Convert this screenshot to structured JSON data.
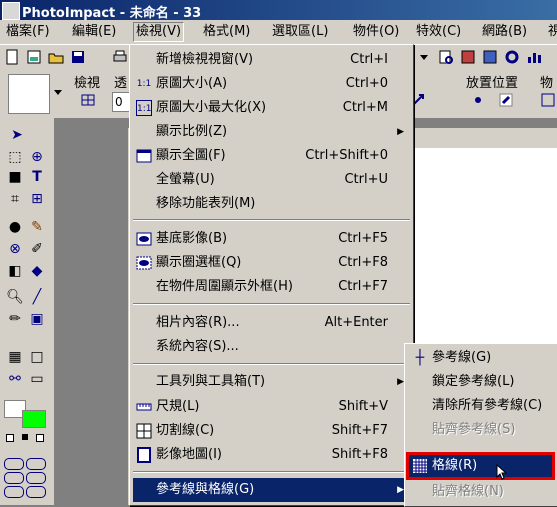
{
  "window": {
    "title": "PhotoImpact - 未命名 - 33"
  },
  "menubar": [
    {
      "label": "檔案(F)",
      "active": false
    },
    {
      "label": "編輯(E)",
      "active": false
    },
    {
      "label": "檢視(V)",
      "active": true
    },
    {
      "label": "格式(M)",
      "active": false
    },
    {
      "label": "選取區(L)",
      "active": false
    },
    {
      "label": "物件(O)",
      "active": false
    },
    {
      "label": "特效(C)",
      "active": false
    },
    {
      "label": "網路(B)",
      "active": false
    },
    {
      "label": "視",
      "active": false
    }
  ],
  "toolbar2": {
    "view_label": "檢視",
    "transparency_label": "透",
    "field_value": "0",
    "placement_label": "放置位置",
    "object_label": "物"
  },
  "view_menu": {
    "items": [
      {
        "label": "新增檢視視窗(V)",
        "accel": "Ctrl+I",
        "icon": ""
      },
      {
        "label": "原圖大小(A)",
        "accel": "Ctrl+0",
        "icon": "1:1"
      },
      {
        "label": "原圖大小最大化(X)",
        "accel": "Ctrl+M",
        "icon": "1:1"
      },
      {
        "label": "顯示比例(Z)",
        "accel": "",
        "icon": "",
        "submenu": true
      },
      {
        "label": "顯示全圖(F)",
        "accel": "Ctrl+Shift+0",
        "icon": "fit-icon"
      },
      {
        "label": "全螢幕(U)",
        "accel": "Ctrl+U",
        "icon": ""
      },
      {
        "label": "移除功能表列(M)",
        "accel": "",
        "icon": ""
      },
      {
        "label": "基底影像(B)",
        "accel": "Ctrl+F5",
        "icon": "eye-icon"
      },
      {
        "label": "顯示圈選框(Q)",
        "accel": "Ctrl+F8",
        "icon": "eye-icon"
      },
      {
        "label": "在物件周圍顯示外框(H)",
        "accel": "Ctrl+F7",
        "icon": ""
      },
      {
        "label": "相片內容(R)...",
        "accel": "Alt+Enter",
        "icon": ""
      },
      {
        "label": "系統內容(S)...",
        "accel": "",
        "icon": ""
      },
      {
        "label": "工具列與工具箱(T)",
        "accel": "",
        "icon": "",
        "submenu": true
      },
      {
        "label": "尺規(L)",
        "accel": "Shift+V",
        "icon": "ruler-icon"
      },
      {
        "label": "切割線(C)",
        "accel": "Shift+F7",
        "icon": "grid-icon"
      },
      {
        "label": "影像地圖(I)",
        "accel": "Shift+F8",
        "icon": "imagemap-icon"
      },
      {
        "label": "參考線與格線(G)",
        "accel": "",
        "icon": "",
        "submenu": true,
        "selected": true
      }
    ]
  },
  "guides_submenu": {
    "items": [
      {
        "label": "參考線(G)",
        "icon": "guide-icon",
        "state": "normal"
      },
      {
        "label": "鎖定參考線(L)",
        "icon": "",
        "state": "normal"
      },
      {
        "label": "清除所有參考線(C)",
        "icon": "",
        "state": "normal"
      },
      {
        "label": "貼齊參考線(S)",
        "icon": "",
        "state": "disabled"
      },
      {
        "label": "格線(R)",
        "icon": "grid-icon",
        "state": "selected"
      },
      {
        "label": "貼齊格線(N)",
        "icon": "",
        "state": "disabled"
      }
    ]
  },
  "colors": {
    "title_bar": "#0a246a",
    "highlight": "#0a246a",
    "callout": "#e00000",
    "foreground_swatch": "#ffffff",
    "background_swatch": "#00ff00"
  }
}
